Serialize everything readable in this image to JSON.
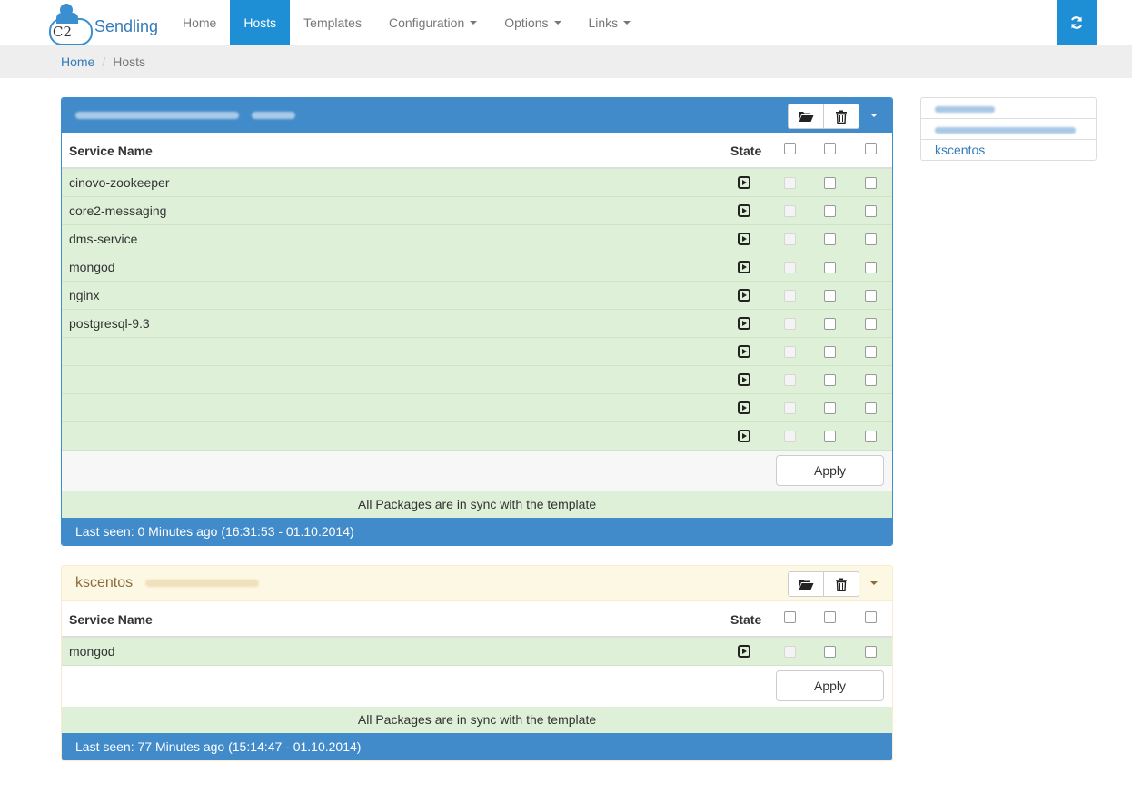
{
  "brand": {
    "name": "Sendling",
    "logo_text": "C2"
  },
  "nav": {
    "items": [
      {
        "label": "Home",
        "active": false,
        "dropdown": false
      },
      {
        "label": "Hosts",
        "active": true,
        "dropdown": false
      },
      {
        "label": "Templates",
        "active": false,
        "dropdown": false
      },
      {
        "label": "Configuration",
        "active": false,
        "dropdown": true
      },
      {
        "label": "Options",
        "active": false,
        "dropdown": true
      },
      {
        "label": "Links",
        "active": false,
        "dropdown": true
      }
    ],
    "refresh_icon": "refresh-icon"
  },
  "breadcrumb": {
    "home": "Home",
    "current": "Hosts"
  },
  "colors": {
    "primary": "#428bca",
    "nav_active": "#1f8fd5",
    "success_bg": "#dff0d8",
    "warning_bg": "#fcf8e3"
  },
  "panels": [
    {
      "title": "",
      "header_col": "Service Name",
      "state_col": "State",
      "services": [
        "cinovo-zookeeper",
        "core2-messaging",
        "dms-service",
        "mongod",
        "nginx",
        "postgresql-9.3",
        "",
        "",
        "",
        ""
      ],
      "apply_label": "Apply",
      "sync_text": "All Packages are in sync with the template",
      "last_seen": "Last seen: 0 Minutes ago (16:31:53 - 01.10.2014)"
    },
    {
      "title": "kscentos",
      "header_col": "Service Name",
      "state_col": "State",
      "services": [
        "mongod"
      ],
      "apply_label": "Apply",
      "sync_text": "All Packages are in sync with the template",
      "last_seen": "Last seen: 77 Minutes ago (15:14:47 - 01.10.2014)"
    }
  ],
  "side_list": [
    "",
    "",
    "kscentos"
  ]
}
